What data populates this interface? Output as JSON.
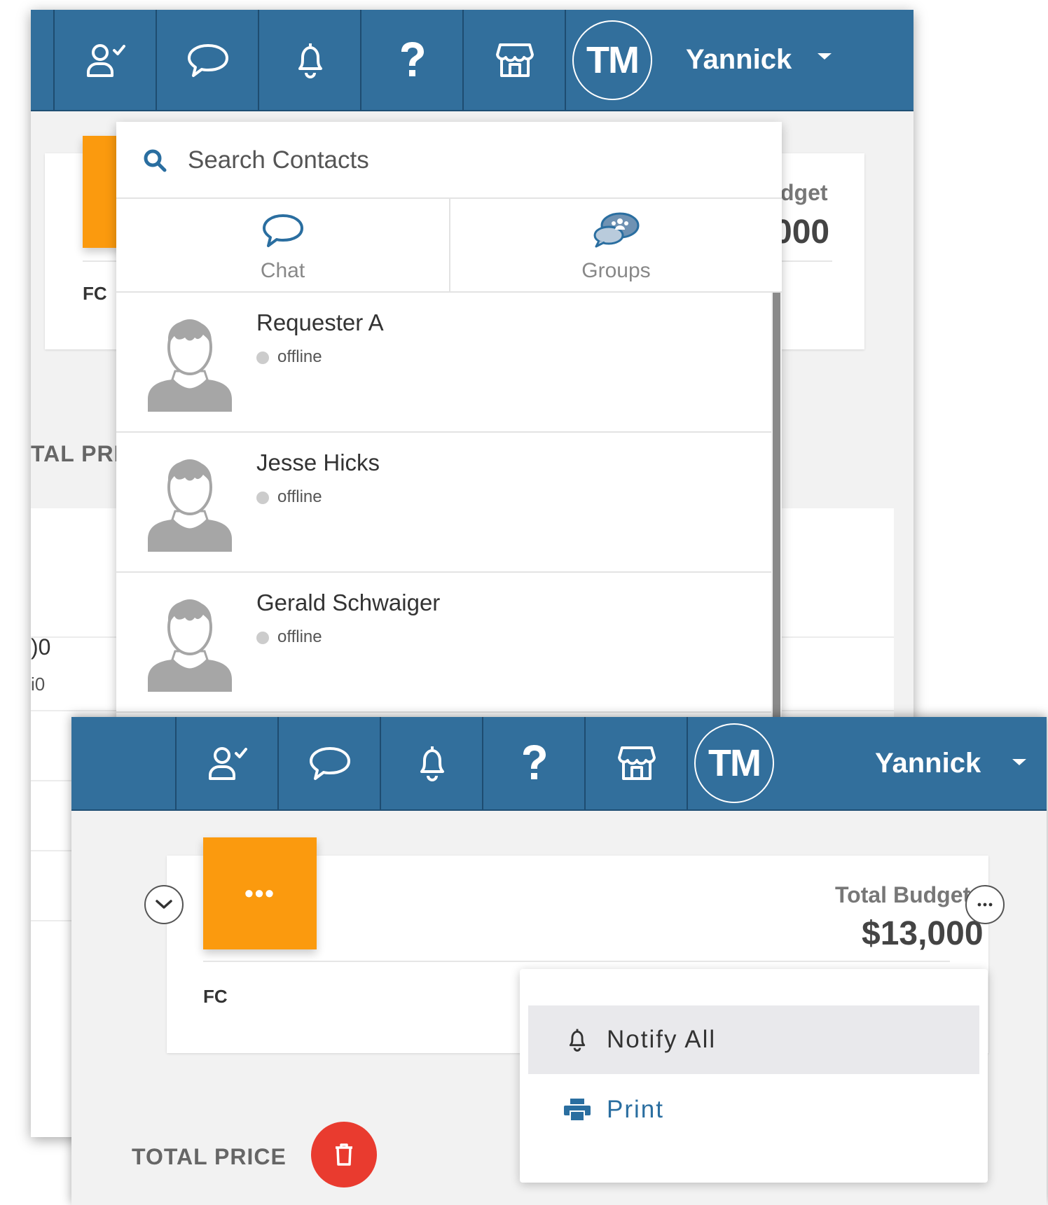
{
  "colors": {
    "navbar": "#326f9c",
    "accent_orange": "#fb9a0e",
    "danger_red": "#e93b2f",
    "link_blue": "#2a6ea0"
  },
  "navbar": {
    "icons": [
      "user-check-icon",
      "chat-bubble-icon",
      "bell-icon",
      "help-icon",
      "store-icon"
    ],
    "avatar_initials": "TM",
    "user_name": "Yannick"
  },
  "contacts_panel": {
    "search_placeholder": "Search Contacts",
    "tabs": [
      {
        "label": "Chat",
        "icon": "chat-bubble-icon"
      },
      {
        "label": "Groups",
        "icon": "groups-icon"
      }
    ],
    "contacts": [
      {
        "name": "Requester A",
        "status": "offline"
      },
      {
        "name": "Jesse Hicks",
        "status": "offline"
      },
      {
        "name": "Gerald Schwaiger",
        "status": "offline"
      }
    ]
  },
  "background_partial": {
    "budget_label": "dget",
    "budget_value": "000",
    "fc_label": "FC",
    "total_price_label": "TAL PRICE",
    "value_1": ")0",
    "value_2": "i0"
  },
  "project_card": {
    "more_label": "•••",
    "fc_label": "FC",
    "budget_label": "Total Budget",
    "budget_value": "$13,000",
    "total_price_label": "TOTAL PRICE"
  },
  "actions_menu": {
    "items": [
      {
        "label": "Notify All",
        "icon": "bell-icon"
      },
      {
        "label": "Print",
        "icon": "printer-icon"
      }
    ]
  }
}
